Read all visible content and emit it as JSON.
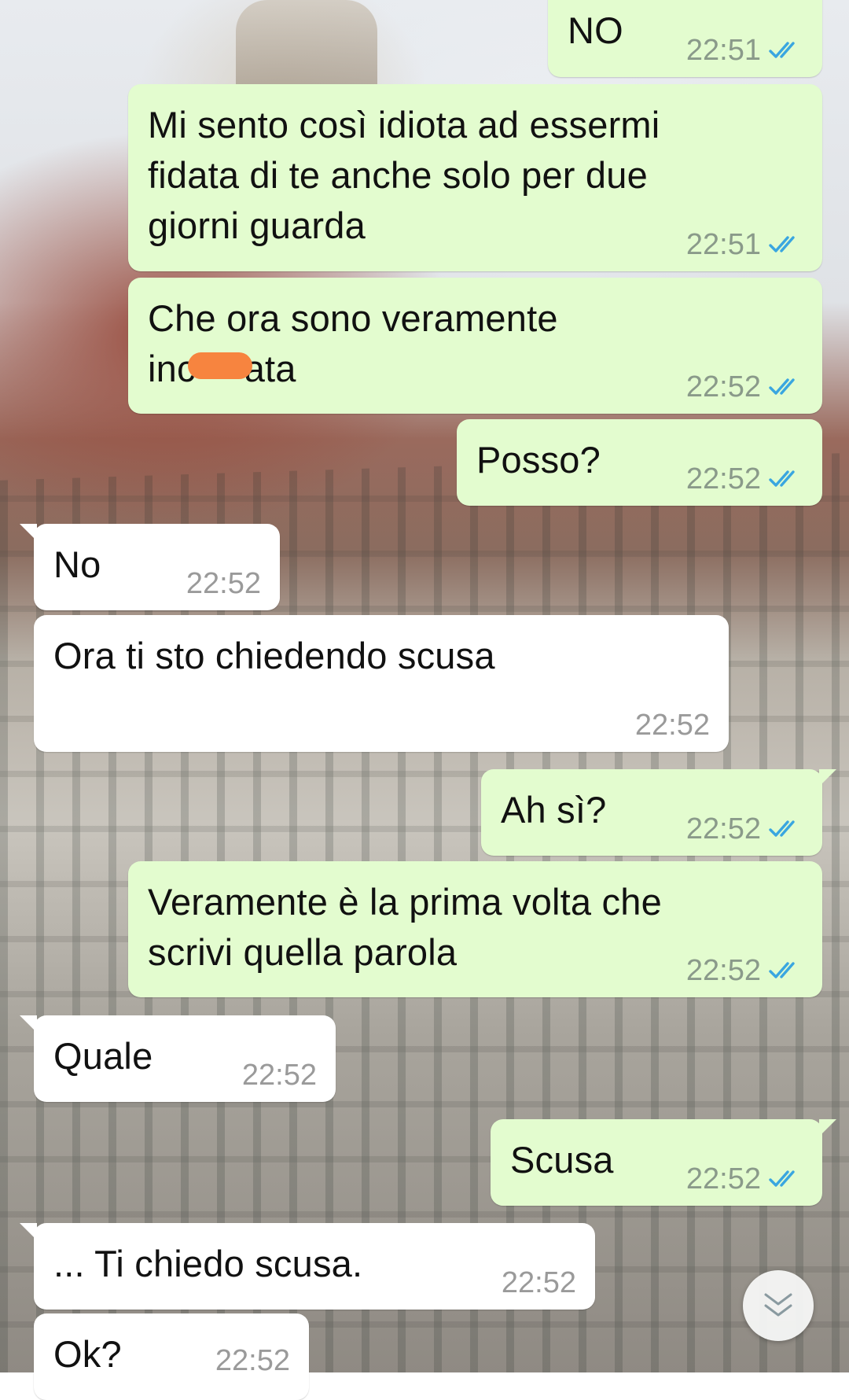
{
  "chat": {
    "messages": [
      {
        "direction": "out",
        "text": "NO",
        "time": "22:51",
        "status": "read"
      },
      {
        "direction": "out",
        "text": "Mi sento così idiota ad essermi\nfidata di te anche solo per due\ngiorni guarda",
        "time": "22:51",
        "status": "read"
      },
      {
        "direction": "out",
        "text_before": "Che ora sono veramente\ninc",
        "text_after": "ata",
        "redacted": true,
        "time": "22:52",
        "status": "read"
      },
      {
        "direction": "out",
        "text": "Posso?",
        "time": "22:52",
        "status": "read"
      },
      {
        "direction": "in",
        "text": "No",
        "time": "22:52"
      },
      {
        "direction": "in",
        "text": "Ora ti sto chiedendo scusa",
        "time": "22:52"
      },
      {
        "direction": "out",
        "text": "Ah sì?",
        "time": "22:52",
        "status": "read"
      },
      {
        "direction": "out",
        "text": "Veramente è la prima volta che\nscrivi quella parola",
        "time": "22:52",
        "status": "read"
      },
      {
        "direction": "in",
        "text": "Quale",
        "time": "22:52"
      },
      {
        "direction": "out",
        "text": "Scusa",
        "time": "22:52",
        "status": "read"
      },
      {
        "direction": "in",
        "text": "... Ti chiedo scusa.",
        "time": "22:52"
      },
      {
        "direction": "in",
        "text": "Ok?",
        "time": "22:52"
      }
    ]
  },
  "colors": {
    "outgoing_bubble": "#e3fccf",
    "incoming_bubble": "#ffffff",
    "read_ticks": "#3aa6e0",
    "redaction": "#f7843f"
  },
  "icons": {
    "read_receipt": "double-check-icon",
    "scroll_down": "double-chevron-down-icon"
  }
}
